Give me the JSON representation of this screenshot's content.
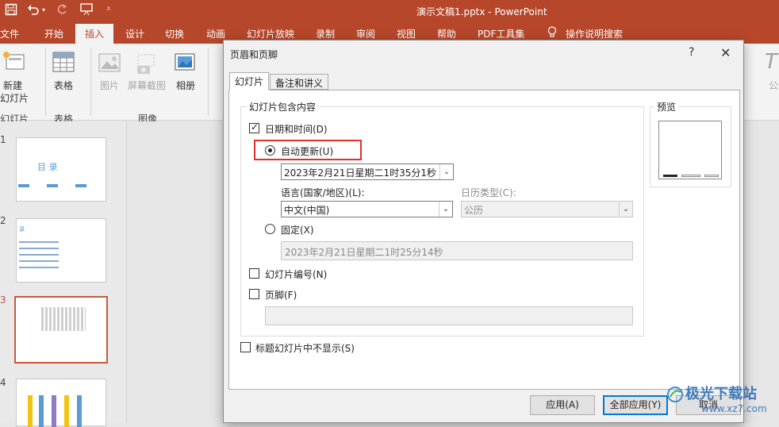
{
  "titlebar": {
    "doc_title": "演示文稿1.pptx  -  PowerPoint"
  },
  "tabs": [
    "文件",
    "开始",
    "插入",
    "设计",
    "切换",
    "动画",
    "幻灯片放映",
    "录制",
    "审阅",
    "视图",
    "帮助",
    "PDF工具集"
  ],
  "active_tab": "插入",
  "tell_me": "操作说明搜索",
  "ribbon": {
    "new_slide": "新建",
    "new_slide2": "幻灯片",
    "table": "表格",
    "picture": "图片",
    "screenshot": "屏幕截图",
    "album": "相册",
    "grp_slides": "幻灯片",
    "grp_table": "表格",
    "grp_images": "图像",
    "right_clip": "公"
  },
  "slides": [
    "1",
    "2",
    "3",
    "4"
  ],
  "slide1": {
    "title": "目    录"
  },
  "slide2": {
    "title": "录"
  },
  "dialog": {
    "title": "页眉和页脚",
    "help": "?",
    "close": "✕",
    "tab_slide": "幻灯片",
    "tab_notes": "备注和讲义",
    "group_title": "幻灯片包含内容",
    "datetime_label": "日期和时间(D)",
    "auto_update_label": "自动更新(U)",
    "auto_date_value": "2023年2月21日星期二1时35分1秒",
    "language_label": "语言(国家/地区)(L):",
    "language_value": "中文(中国)",
    "calendar_label": "日历类型(C):",
    "calendar_value": "公历",
    "fixed_label": "固定(X)",
    "fixed_value": "2023年2月21日星期二1时25分14秒",
    "slide_number_label": "幻灯片编号(N)",
    "footer_label": "页脚(F)",
    "footer_value": "",
    "hide_title_label": "标题幻灯片中不显示(S)",
    "preview_label": "预览",
    "apply": "应用(A)",
    "apply_all": "全部应用(Y)",
    "cancel": "取消"
  },
  "watermark": {
    "text1": "极光下载站",
    "text2": "www.xz7.com"
  }
}
